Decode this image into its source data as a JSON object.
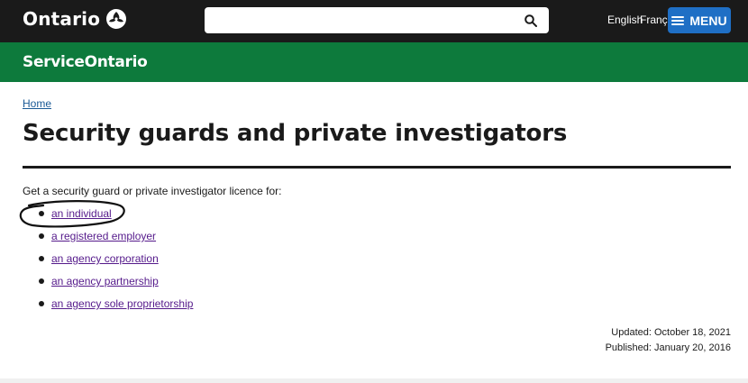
{
  "header": {
    "logo_text": "Ontario",
    "logo_icon": "trillium-icon",
    "search": {
      "value": "",
      "placeholder": "",
      "icon": "search-icon"
    },
    "language_english": "English",
    "language_french": "Français",
    "menu_label": "MENU",
    "menu_icon": "hamburger-icon"
  },
  "service_bar": {
    "logo_text": "ServiceOntario"
  },
  "breadcrumb": {
    "home": "Home"
  },
  "main": {
    "title": "Security guards and private investigators",
    "intro": "Get a security guard or private investigator licence for:",
    "links": [
      "an individual",
      "a registered employer",
      "an agency corporation",
      "an agency partnership",
      "an agency sole proprietorship"
    ],
    "updated": "Updated: October 18, 2021",
    "published": "Published: January 20, 2016"
  },
  "colors": {
    "topbar": "#1a1a1a",
    "service_green": "#0d7a3c",
    "menu_blue": "#1f6fc5",
    "link_visited": "#551a8b",
    "breadcrumb_link": "#1a5a96"
  }
}
